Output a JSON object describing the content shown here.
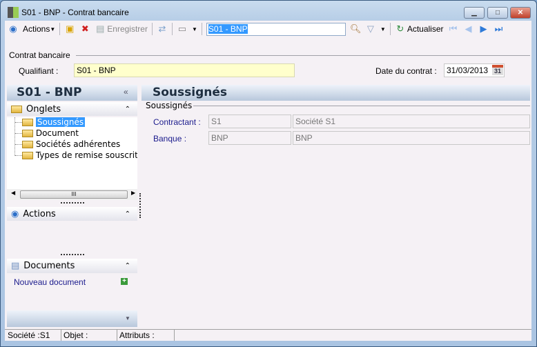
{
  "window": {
    "title": "S01 - BNP -  Contrat bancaire"
  },
  "toolbar": {
    "actions": "Actions",
    "save": "Enregistrer",
    "search_value": "S01 - BNP",
    "refresh": "Actualiser"
  },
  "header": {
    "group": "Contrat bancaire",
    "qualifiant_label": "Qualifiant :",
    "qualifiant_value": "S01 - BNP",
    "date_label": "Date du contrat :",
    "date_value": "31/03/2013",
    "calendar_day": "31"
  },
  "sidebar": {
    "title": "S01 - BNP",
    "onglets": "Onglets",
    "tree": [
      "Soussignés",
      "Document",
      "Sociétés adhérentes",
      "Types de remise souscrits"
    ],
    "scroll_thumb": "III",
    "actions": "Actions",
    "documents": "Documents",
    "new_document": "Nouveau document"
  },
  "main": {
    "title": "Soussignés",
    "group": "Soussignés",
    "rows": [
      {
        "label": "Contractant :",
        "code": "S1",
        "name": "Société S1"
      },
      {
        "label": "Banque :",
        "code": "BNP",
        "name": "BNP"
      }
    ]
  },
  "statusbar": {
    "societe": "Société :S1",
    "objet": "Objet :",
    "attributs": "Attributs :"
  },
  "colors": {
    "accent": "#3399ff",
    "link": "#1a1a8c",
    "qualifiant_bg": "#ffffcc"
  }
}
